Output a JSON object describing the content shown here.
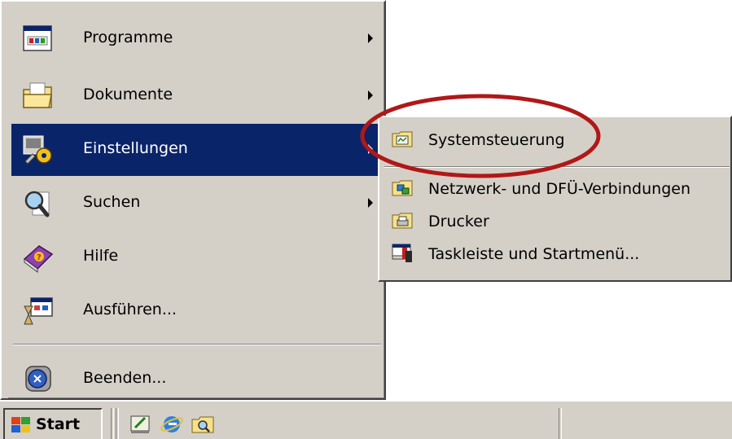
{
  "start_menu": {
    "items": [
      {
        "label": "Programme",
        "icon": "programs-icon",
        "submenu": true
      },
      {
        "label": "Dokumente",
        "icon": "documents-folder-icon",
        "submenu": true
      },
      {
        "label": "Einstellungen",
        "icon": "settings-icon",
        "submenu": true,
        "selected": true
      },
      {
        "label": "Suchen",
        "icon": "search-magnifier-icon",
        "submenu": true
      },
      {
        "label": "Hilfe",
        "icon": "help-book-icon",
        "submenu": false
      },
      {
        "label": "Ausführen...",
        "icon": "run-icon",
        "submenu": false
      },
      {
        "label": "Beenden...",
        "icon": "shutdown-icon",
        "submenu": false
      }
    ]
  },
  "settings_submenu": {
    "items": [
      {
        "label": "Systemsteuerung",
        "icon": "control-panel-icon",
        "highlighted": true
      },
      {
        "label": "Netzwerk- und DFÜ-Verbindungen",
        "icon": "network-connections-icon"
      },
      {
        "label": "Drucker",
        "icon": "printers-folder-icon"
      },
      {
        "label": "Taskleiste und Startmenü...",
        "icon": "taskbar-icon"
      }
    ]
  },
  "taskbar": {
    "start_label": "Start",
    "quick_launch": [
      "show-desktop-icon",
      "internet-explorer-icon",
      "explorer-icon"
    ]
  },
  "colors": {
    "menu_bg": "#d4d0c8",
    "selection": "#0a246a",
    "highlight_ellipse": "#b01818"
  }
}
